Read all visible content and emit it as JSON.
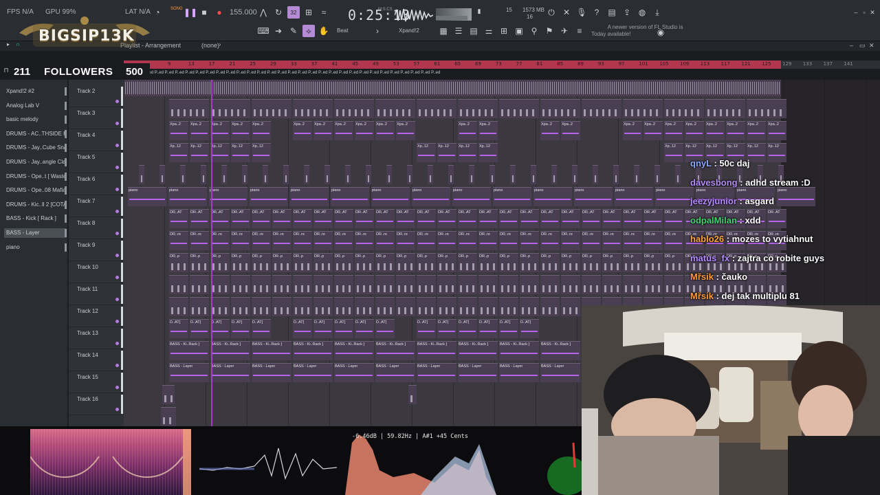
{
  "toolbar": {
    "fps": "FPS N/A",
    "gpu": "GPU 99%",
    "ram": "LAT N/A",
    "mode_song": "SONG",
    "tempo": "155.000",
    "time": "0:25:13",
    "time_unit": "M:S:CS",
    "mem": "1573 MB",
    "voices": "16",
    "snap": "Beat",
    "plugin": "Xpand!2",
    "news_title": "Today",
    "news_text": "A newer version of FL Studio is available!",
    "small_32": "32",
    "cpu_num": "15"
  },
  "logo": {
    "text": "BIGSIP13K"
  },
  "followers": {
    "count": "211",
    "label": "FOLLOWERS",
    "goal": "500"
  },
  "playlist": {
    "title": "Playlist - Arrangement",
    "pattern": "(none)"
  },
  "ruler": {
    "labels": [
      "9",
      "13",
      "17",
      "21",
      "25",
      "29",
      "33",
      "37",
      "41",
      "45",
      "49",
      "53",
      "57",
      "61",
      "65",
      "69",
      "73",
      "77",
      "81",
      "85",
      "89",
      "93",
      "97",
      "101",
      "105",
      "109",
      "113",
      "117",
      "121",
      "125",
      "129",
      "133",
      "137",
      "141"
    ]
  },
  "markers_text": "P..ed  P..ed  P..ed  P..ed  P..ed  P..ed  P..ed  P..ed  P..ed  P..ed  P..ed  P..ed  P..ed  P..ed  P..ed  P..ed  P..ed  P..ed  P..ed  P..ed  P..ed  P..ed  P..ed  P..ed  P..ed  P..ed  P..ed  P..ed  P..ed  P..ed  P..ed",
  "channels": [
    "Xpand!2 #2",
    "Analog Lab V",
    "basic melody",
    "DRUMS - AC..THSIDE HAT",
    "DRUMS - Jay..Cube Snare",
    "DRUMS - Jay..angle Clap",
    "DRUMS - Ope..t [ Waste ]",
    "DRUMS - Ope..08 Mafia",
    "DRUMS - Kic..ll 2 [COTAT",
    "BASS - Kick [ Rack ]",
    "BASS - Layer",
    "piano"
  ],
  "tracks": [
    "Track 2",
    "Track 3",
    "Track 4",
    "Track 5",
    "Track 6",
    "Track 7",
    "Track 8",
    "Track 9",
    "Track 10",
    "Track 11",
    "Track 12",
    "Track 13",
    "Track 14",
    "Track 15",
    "Track 16"
  ],
  "clip_labels": {
    "xpa": "Xpa..2",
    "xp12": "Xp..12",
    "piano": "piano",
    "drat": "DR..AT",
    "drre": "DR..re",
    "drp": "DR..p",
    "dat": "D..AT]",
    "bassrack": "BASS - Ki..Rack ]",
    "basslayer": "BASS - Layer"
  },
  "chat": [
    {
      "user": "qnyL",
      "msg": " : 50c daj",
      "color": "#8aa7ff"
    },
    {
      "user": "davesbong",
      "msg": " : adhd stream :D",
      "color": "#b58cff"
    },
    {
      "user": "jeezyjunior",
      "msg": " : asgard",
      "color": "#b58cff"
    },
    {
      "user": "odpalMilan",
      "msg": " : xdd",
      "color": "#3fd36a"
    },
    {
      "user": "hablo26",
      "msg": " : mozes to vytiahnut",
      "color": "#ffa23a"
    },
    {
      "user": "matus_fx",
      "msg": " : zajtra co robite guys",
      "color": "#b58cff"
    },
    {
      "user": "Mřsik",
      "msg": " : čauko",
      "color": "#ff9b3a"
    },
    {
      "user": "Mřsik",
      "msg": " : dej tak multiplu 81",
      "color": "#ff9b3a"
    }
  ],
  "viz": {
    "readout": "-6.46dB | 59.82Hz | A#1 +45 Cents"
  },
  "colors": {
    "accent": "#b564ec",
    "ruler": "#b2364d",
    "playhead": "#a43ec3"
  }
}
